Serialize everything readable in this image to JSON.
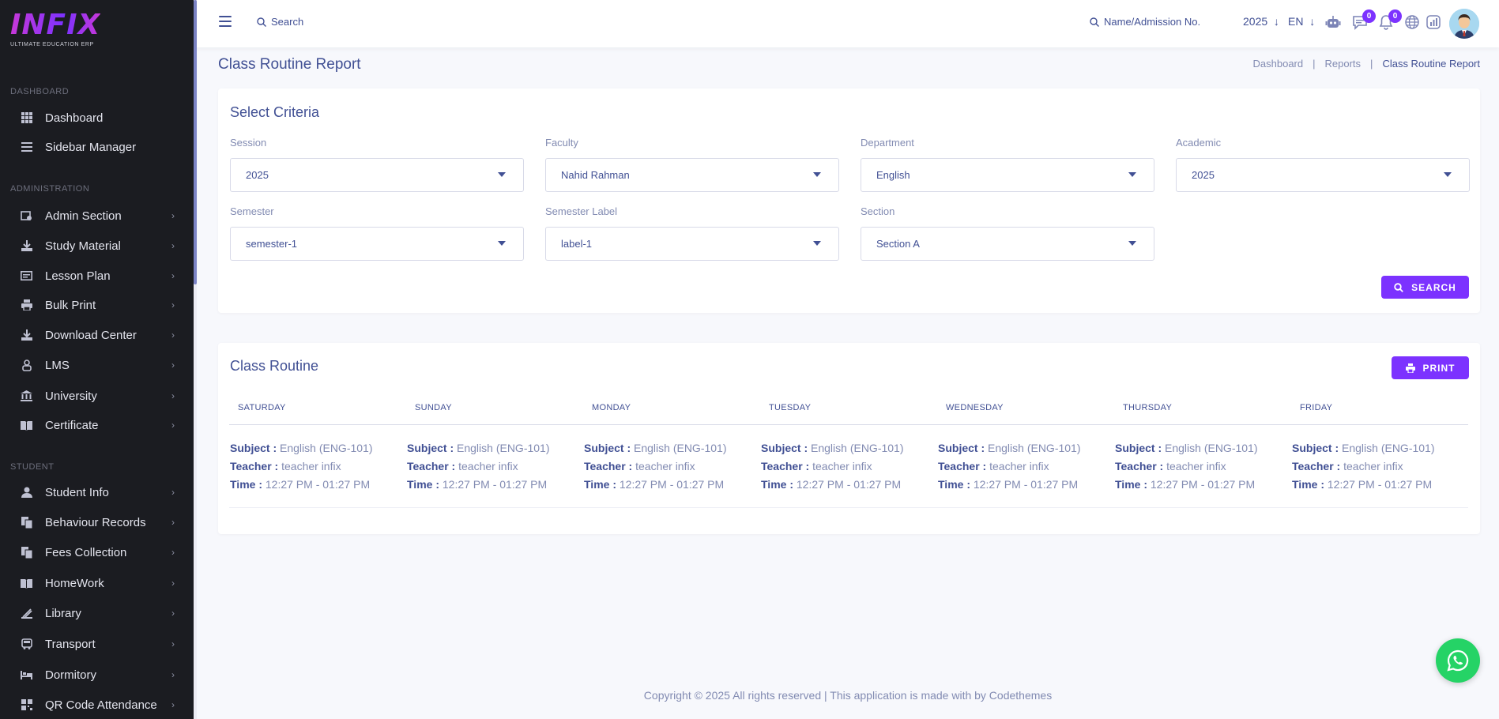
{
  "logo": {
    "text": "INFIX",
    "subtitle": "ULTIMATE EDUCATION ERP"
  },
  "sidebar": {
    "sections": [
      {
        "title": "DASHBOARD"
      },
      {
        "title": "ADMINISTRATION"
      },
      {
        "title": "STUDENT"
      }
    ],
    "items": [
      {
        "label": "Dashboard",
        "icon": "grid-icon"
      },
      {
        "label": "Sidebar Manager",
        "icon": "list-icon"
      },
      {
        "label": "Admin Section",
        "icon": "admin-icon"
      },
      {
        "label": "Study Material",
        "icon": "download-icon"
      },
      {
        "label": "Lesson Plan",
        "icon": "lesson-icon"
      },
      {
        "label": "Bulk Print",
        "icon": "printer-icon"
      },
      {
        "label": "Download Center",
        "icon": "download-icon"
      },
      {
        "label": "LMS",
        "icon": "lms-icon"
      },
      {
        "label": "University",
        "icon": "university-icon"
      },
      {
        "label": "Certificate",
        "icon": "book-icon"
      },
      {
        "label": "Student Info",
        "icon": "user-icon"
      },
      {
        "label": "Behaviour Records",
        "icon": "records-icon"
      },
      {
        "label": "Fees Collection",
        "icon": "fees-icon"
      },
      {
        "label": "HomeWork",
        "icon": "book-icon"
      },
      {
        "label": "Library",
        "icon": "library-icon"
      },
      {
        "label": "Transport",
        "icon": "bus-icon"
      },
      {
        "label": "Dormitory",
        "icon": "bed-icon"
      },
      {
        "label": "QR Code Attendance",
        "icon": "qr-icon"
      }
    ]
  },
  "topbar": {
    "search_label": "Search",
    "admission_search_label": "Name/Admission No.",
    "year": "2025",
    "language": "EN",
    "chat_badge": "0",
    "notification_badge": "0"
  },
  "page": {
    "title": "Class Routine Report",
    "breadcrumb": [
      "Dashboard",
      "Reports",
      "Class Routine Report"
    ]
  },
  "criteria": {
    "title": "Select Criteria",
    "fields": [
      {
        "label": "Session",
        "value": "2025"
      },
      {
        "label": "Faculty",
        "value": "Nahid Rahman"
      },
      {
        "label": "Department",
        "value": "English"
      },
      {
        "label": "Academic",
        "value": "2025"
      },
      {
        "label": "Semester",
        "value": "semester-1"
      },
      {
        "label": "Semester Label",
        "value": "label-1"
      },
      {
        "label": "Section",
        "value": "Section A"
      }
    ],
    "search_button": "SEARCH"
  },
  "routine": {
    "title": "Class Routine",
    "print_button": "PRINT",
    "labels": {
      "subject": "Subject :",
      "teacher": "Teacher :",
      "time": "Time :"
    },
    "days": [
      {
        "day": "SATURDAY",
        "subject": "English (ENG-101)",
        "teacher": "teacher infix",
        "time": "12:27 PM - 01:27 PM"
      },
      {
        "day": "SUNDAY",
        "subject": "English (ENG-101)",
        "teacher": "teacher infix",
        "time": "12:27 PM - 01:27 PM"
      },
      {
        "day": "MONDAY",
        "subject": "English (ENG-101)",
        "teacher": "teacher infix",
        "time": "12:27 PM - 01:27 PM"
      },
      {
        "day": "TUESDAY",
        "subject": "English (ENG-101)",
        "teacher": "teacher infix",
        "time": "12:27 PM - 01:27 PM"
      },
      {
        "day": "WEDNESDAY",
        "subject": "English (ENG-101)",
        "teacher": "teacher infix",
        "time": "12:27 PM - 01:27 PM"
      },
      {
        "day": "THURSDAY",
        "subject": "English (ENG-101)",
        "teacher": "teacher infix",
        "time": "12:27 PM - 01:27 PM"
      },
      {
        "day": "FRIDAY",
        "subject": "English (ENG-101)",
        "teacher": "teacher infix",
        "time": "12:27 PM - 01:27 PM"
      }
    ]
  },
  "footer": {
    "text": "Copyright © 2025 All rights reserved | This application is made with by Codethemes"
  },
  "colors": {
    "accent": "#7c32ff",
    "text": "#415094",
    "muted": "#828bb2",
    "sidebar": "#1b1c21",
    "whatsapp": "#25d366"
  }
}
